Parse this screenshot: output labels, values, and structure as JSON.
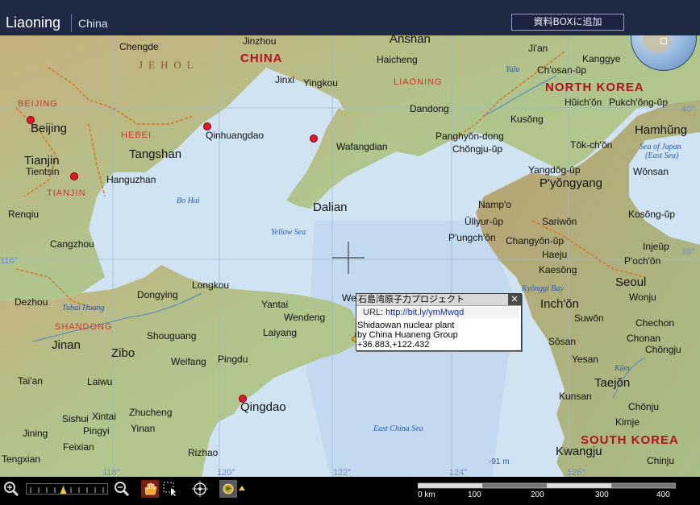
{
  "header": {
    "title": "Liaoning",
    "subtitle": "China",
    "box_button_label": "資料BOXに追加"
  },
  "map": {
    "countries": [
      {
        "id": "china",
        "text": "CHINA"
      },
      {
        "id": "north-korea",
        "text": "NORTH KOREA"
      },
      {
        "id": "south-korea",
        "text": "SOUTH KOREA"
      }
    ],
    "regions": [
      {
        "id": "jehol",
        "text": "JEHOL"
      },
      {
        "id": "liaoning",
        "text": "LIAONING"
      },
      {
        "id": "beijing",
        "text": "BEIJING"
      },
      {
        "id": "hebei",
        "text": "HEBEI"
      },
      {
        "id": "tianjin",
        "text": "TIANJIN"
      },
      {
        "id": "shandong",
        "text": "SHANDONG"
      }
    ],
    "cities": [
      {
        "id": "chengde",
        "text": "Chengde"
      },
      {
        "id": "jinzhou",
        "text": "Jinzhou"
      },
      {
        "id": "anshan",
        "text": "Anshan"
      },
      {
        "id": "haicheng",
        "text": "Haicheng"
      },
      {
        "id": "jinxi",
        "text": "Jinxi"
      },
      {
        "id": "yingkou",
        "text": "Yingkou"
      },
      {
        "id": "beijing-city",
        "text": "Beijing"
      },
      {
        "id": "qinhuangdao",
        "text": "Qinhuangdao"
      },
      {
        "id": "tangshan",
        "text": "Tangshan"
      },
      {
        "id": "tianjin-city",
        "text": "Tianjin"
      },
      {
        "id": "tientsin",
        "text": "Tientsin"
      },
      {
        "id": "hanguzhan",
        "text": "Hanguzhan"
      },
      {
        "id": "renqiu",
        "text": "Renqiu"
      },
      {
        "id": "cangzhou",
        "text": "Cangzhou"
      },
      {
        "id": "dezhou",
        "text": "Dezhou"
      },
      {
        "id": "wafangdian",
        "text": "Wafangdian"
      },
      {
        "id": "dandong",
        "text": "Dandong"
      },
      {
        "id": "dalian",
        "text": "Dalian"
      },
      {
        "id": "longkou",
        "text": "Longkou"
      },
      {
        "id": "dongying",
        "text": "Dongying"
      },
      {
        "id": "yantai",
        "text": "Yantai"
      },
      {
        "id": "wendeng",
        "text": "Wendeng"
      },
      {
        "id": "we",
        "text": "We"
      },
      {
        "id": "laiyang",
        "text": "Laiyang"
      },
      {
        "id": "shouguang",
        "text": "Shouguang"
      },
      {
        "id": "jinan",
        "text": "Jinan"
      },
      {
        "id": "zibo",
        "text": "Zibo"
      },
      {
        "id": "weifang",
        "text": "Weifang"
      },
      {
        "id": "pingdu",
        "text": "Pingdu"
      },
      {
        "id": "taian",
        "text": "Tai'an"
      },
      {
        "id": "laiwu",
        "text": "Laiwu"
      },
      {
        "id": "sishui",
        "text": "Sishui"
      },
      {
        "id": "xintai",
        "text": "Xintai"
      },
      {
        "id": "zhucheng",
        "text": "Zhucheng"
      },
      {
        "id": "jining",
        "text": "Jining"
      },
      {
        "id": "pingyi",
        "text": "Pingyi"
      },
      {
        "id": "yinan",
        "text": "Yinan"
      },
      {
        "id": "feixian",
        "text": "Feixian"
      },
      {
        "id": "qingdao",
        "text": "Qingdao"
      },
      {
        "id": "tengxian",
        "text": "Tengxian"
      },
      {
        "id": "rizhao",
        "text": "Rizhao"
      },
      {
        "id": "jian",
        "text": "Ji'an"
      },
      {
        "id": "kanggye",
        "text": "Kanggye"
      },
      {
        "id": "chosan-up",
        "text": "Ch'osan-ŭp"
      },
      {
        "id": "huichon",
        "text": "Hŭich'ŏn"
      },
      {
        "id": "pukchong-up",
        "text": "Pukch'ŏng-ŭp"
      },
      {
        "id": "kusong",
        "text": "Kusŏng"
      },
      {
        "id": "hamhung",
        "text": "Hamhŭng"
      },
      {
        "id": "panghyon",
        "text": "Panghyŏn-dong"
      },
      {
        "id": "chongju-up",
        "text": "Chŏngju-ŭp"
      },
      {
        "id": "tokchon",
        "text": "Tŏk-ch'ŏn"
      },
      {
        "id": "yangdok",
        "text": "Yangdŏg-ŭp"
      },
      {
        "id": "wonsan",
        "text": "Wŏnsan"
      },
      {
        "id": "pyongyang",
        "text": "P'yŏngyang"
      },
      {
        "id": "nampo",
        "text": "Namp'o"
      },
      {
        "id": "kosong-up",
        "text": "Kosŏng-ŭp"
      },
      {
        "id": "ullyul",
        "text": "Ŭllyur-ŭp"
      },
      {
        "id": "sariwon",
        "text": "Sariwŏn"
      },
      {
        "id": "pyongchon",
        "text": "P'ungch'ŏn"
      },
      {
        "id": "injeup",
        "text": "Injeŭp"
      },
      {
        "id": "changyon",
        "text": "Changyŏn-ŭp"
      },
      {
        "id": "haeju",
        "text": "Haeju"
      },
      {
        "id": "pochon",
        "text": "P'och'ŏn"
      },
      {
        "id": "kaesong",
        "text": "Kaesŏng"
      },
      {
        "id": "seoul",
        "text": "Seoul"
      },
      {
        "id": "wonju",
        "text": "Wonju"
      },
      {
        "id": "inchon",
        "text": "Inch'ŏn"
      },
      {
        "id": "suwon",
        "text": "Suwŏn"
      },
      {
        "id": "chechon",
        "text": "Chechon"
      },
      {
        "id": "chonan",
        "text": "Chonan"
      },
      {
        "id": "chongju",
        "text": "Chŏngju"
      },
      {
        "id": "sosan",
        "text": "Sŏsan"
      },
      {
        "id": "yesan",
        "text": "Yesan"
      },
      {
        "id": "taejon",
        "text": "Taejŏn"
      },
      {
        "id": "kunsan",
        "text": "Kunsan"
      },
      {
        "id": "chonju",
        "text": "Chŏnju"
      },
      {
        "id": "kimje",
        "text": "Kimje"
      },
      {
        "id": "kwangju",
        "text": "Kwangju"
      },
      {
        "id": "chinju",
        "text": "Chinju"
      }
    ],
    "water": [
      {
        "id": "bo-hai",
        "text": "Bo Hai"
      },
      {
        "id": "yellow-sea",
        "text": "Yellow Sea"
      },
      {
        "id": "tuhai-huang",
        "text": "Tuhai Huang"
      },
      {
        "id": "kyonggi-bay",
        "text": "Kyŏnggi Bay"
      },
      {
        "id": "east-china-sea",
        "text": "East China Sea"
      },
      {
        "id": "sea-of-japan-1",
        "text": "Sea of Japan"
      },
      {
        "id": "sea-of-japan-2",
        "text": "(East Sea)"
      },
      {
        "id": "kum",
        "text": "Kŭm"
      },
      {
        "id": "yalu",
        "text": "Yalu"
      }
    ],
    "coordinates": [
      {
        "id": "lon-118",
        "text": "118°"
      },
      {
        "id": "lon-120",
        "text": "120°"
      },
      {
        "id": "lon-122",
        "text": "122°"
      },
      {
        "id": "lon-124",
        "text": "124°"
      },
      {
        "id": "lon-126",
        "text": "126°"
      },
      {
        "id": "lat-40",
        "text": "40°"
      },
      {
        "id": "lat-38",
        "text": "38°"
      },
      {
        "id": "lon-116",
        "text": "116°"
      }
    ],
    "depth_label": "-91 m"
  },
  "popup": {
    "title": "石島湾原子力プロジェクト",
    "close_label": "✕",
    "url_label": "URL:",
    "url": "http://bit.ly/ymMwqd",
    "line1": "Shidaowan nuclear plant",
    "line2": "by  China Huaneng Group",
    "line3": "+36.883,+122.432"
  },
  "toolbar": {
    "icons": [
      "zoom-in-icon",
      "zoom-out-icon",
      "hand-pan-icon",
      "select-arrow-icon",
      "crosshair-icon",
      "globe-icon",
      "arrow-up-icon"
    ],
    "zoom_level_fraction": 0.45,
    "scale_labels": [
      "0 km",
      "100",
      "200",
      "300",
      "400"
    ]
  },
  "colors": {
    "sea": "#cfe3f3",
    "land_low": "#a9c68a",
    "land_high": "#c9ad79",
    "border": "#d9742c",
    "country_label": "#b3121d",
    "header_bg": "#1e2a44"
  }
}
